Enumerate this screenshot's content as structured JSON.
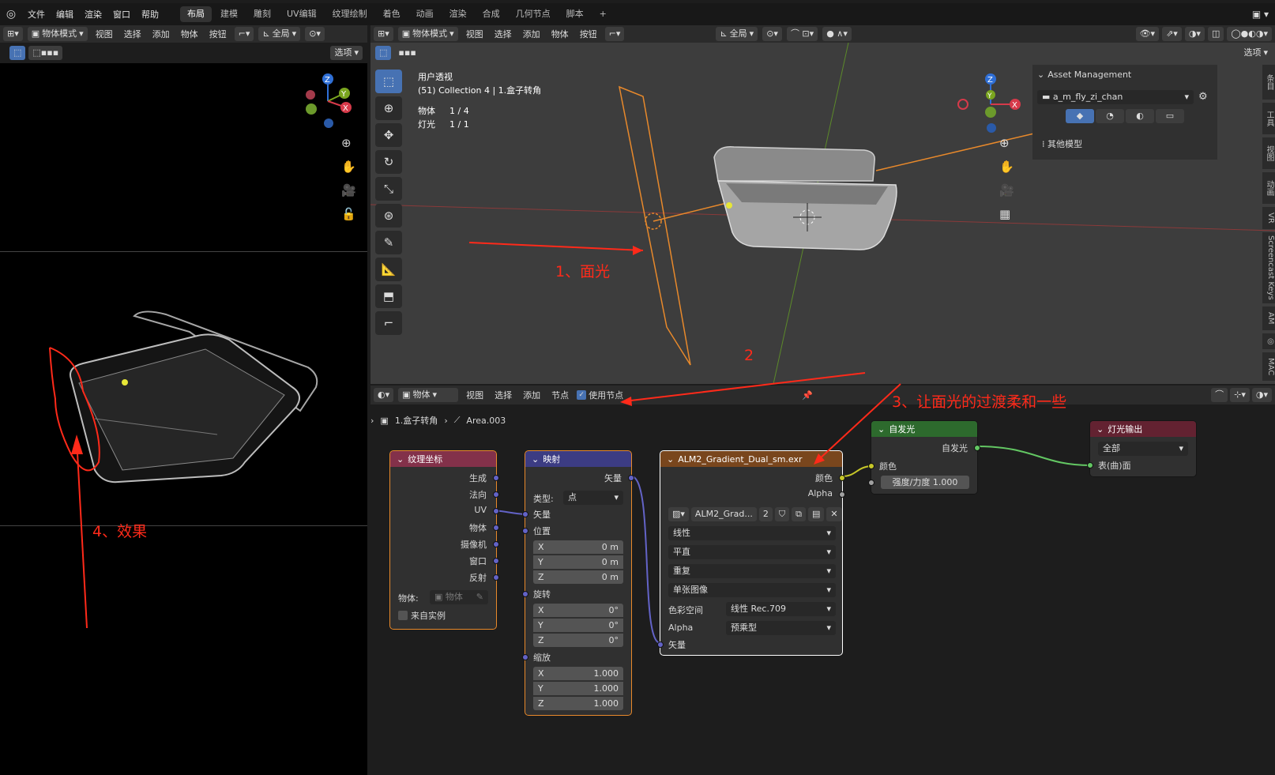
{
  "topbar": {
    "menus": [
      "文件",
      "编辑",
      "渲染",
      "窗口",
      "帮助"
    ],
    "tabs": [
      "布局",
      "建模",
      "雕刻",
      "UV编辑",
      "纹理绘制",
      "着色",
      "动画",
      "渲染",
      "合成",
      "几何节点",
      "脚本"
    ],
    "active_tab": "布局",
    "add_tab": "+"
  },
  "left_header": {
    "mode": "物体模式",
    "menus": [
      "视图",
      "选择",
      "添加",
      "物体",
      "按钮"
    ],
    "transform": "全局",
    "options": "选项"
  },
  "main_header": {
    "mode": "物体模式",
    "menus": [
      "视图",
      "选择",
      "添加",
      "物体",
      "按钮"
    ],
    "transform": "全局",
    "options": "选项"
  },
  "viewport": {
    "view_name": "用户透视",
    "collection": "(51) Collection 4 | 1.盒子转角",
    "stats": [
      {
        "label": "物体",
        "value": "1 / 4"
      },
      {
        "label": "灯光",
        "value": "1 / 1"
      }
    ]
  },
  "asset_panel": {
    "title": "Asset Management",
    "library": "a_m_fly_zi_chan",
    "category": "其他模型"
  },
  "side_tabs": [
    "条目",
    "工具",
    "视图",
    "动画",
    "VR",
    "Screencast Keys",
    "AM",
    "MAC"
  ],
  "node_header": {
    "type": "物体",
    "menus": [
      "视图",
      "选择",
      "添加",
      "节点"
    ],
    "use_nodes": "使用节点"
  },
  "breadcrumb": {
    "object": "1.盒子转角",
    "light": "Area.003"
  },
  "nodes": {
    "texcoord": {
      "title": "纹理坐标",
      "outputs": [
        "生成",
        "法向",
        "UV",
        "物体",
        "摄像机",
        "窗口",
        "反射"
      ],
      "object_label": "物体:",
      "object_placeholder": "物体",
      "from_instancer": "来自实例"
    },
    "mapping": {
      "title": "映射",
      "output": "矢量",
      "type_label": "类型:",
      "type_value": "点",
      "vector": "矢量",
      "location": "位置",
      "rotation": "旋转",
      "scale": "缩放",
      "loc": [
        {
          "axis": "X",
          "val": "0 m"
        },
        {
          "axis": "Y",
          "val": "0 m"
        },
        {
          "axis": "Z",
          "val": "0 m"
        }
      ],
      "rot": [
        {
          "axis": "X",
          "val": "0°"
        },
        {
          "axis": "Y",
          "val": "0°"
        },
        {
          "axis": "Z",
          "val": "0°"
        }
      ],
      "scl": [
        {
          "axis": "X",
          "val": "1.000"
        },
        {
          "axis": "Y",
          "val": "1.000"
        },
        {
          "axis": "Z",
          "val": "1.000"
        }
      ]
    },
    "image": {
      "title": "ALM2_Gradient_Dual_sm.exr",
      "out_color": "颜色",
      "out_alpha": "Alpha",
      "img_name": "ALM2_Grad...",
      "users": "2",
      "interp": "线性",
      "proj": "平直",
      "ext": "重复",
      "source": "单张图像",
      "colorspace_label": "色彩空间",
      "colorspace": "线性 Rec.709",
      "alpha_label": "Alpha",
      "alpha": "预乘型",
      "vector": "矢量"
    },
    "emission": {
      "title": "自发光",
      "output": "自发光",
      "color": "颜色",
      "strength_label": "强度/力度",
      "strength": "1.000"
    },
    "output": {
      "title": "灯光输出",
      "target": "全部",
      "surface": "表(曲)面"
    }
  },
  "annotations": {
    "a1": "1、面光",
    "a2": "2",
    "a3": "3、让面光的过渡柔和一些",
    "a4": "4、效果"
  },
  "colors": {
    "texcoord_header": "#83314a",
    "mapping_header": "#3c3c83",
    "image_header": "#79461d",
    "emission_header": "#2d6a2d",
    "output_header": "#632231",
    "annotation": "#ff2a1a"
  }
}
